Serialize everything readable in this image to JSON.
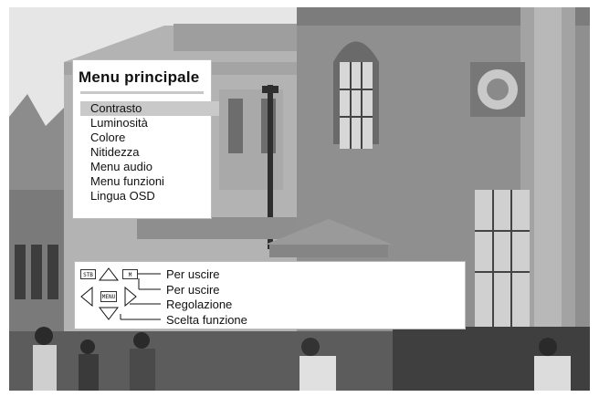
{
  "menu": {
    "title": "Menu principale",
    "items": [
      {
        "label": "Contrasto",
        "selected": true
      },
      {
        "label": "Luminosità",
        "selected": false
      },
      {
        "label": "Colore",
        "selected": false
      },
      {
        "label": "Nitidezza",
        "selected": false
      },
      {
        "label": "Menu audio",
        "selected": false
      },
      {
        "label": "Menu funzioni",
        "selected": false
      },
      {
        "label": "Lingua OSD",
        "selected": false
      }
    ],
    "highlight_color": "#c9c9c9"
  },
  "hints": {
    "keys": {
      "standby": "STB",
      "menu_small": "M",
      "menu_center": "MENU"
    },
    "icons": [
      "left-arrow-icon",
      "up-arrow-icon",
      "right-arrow-icon",
      "down-arrow-icon"
    ],
    "labels": [
      "Per uscire",
      "Per uscire",
      "Regolazione",
      "Scelta funzione"
    ]
  }
}
